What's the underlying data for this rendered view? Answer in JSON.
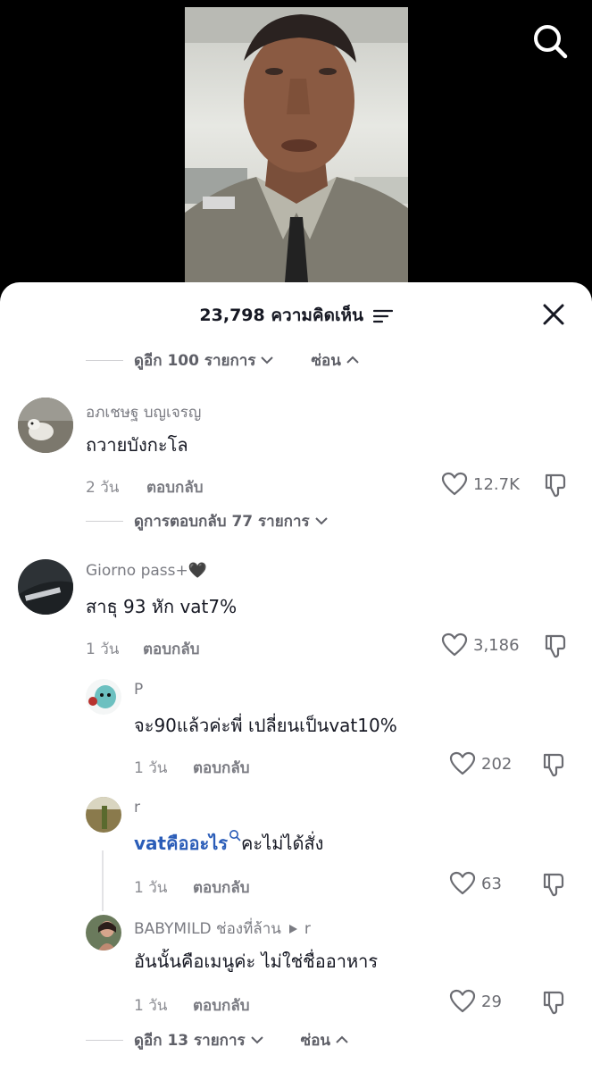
{
  "header": {
    "comment_count": "23,798 ความคิดเห็น"
  },
  "top_expand": {
    "more_label": "ดูอีก 100 รายการ",
    "hide_label": "ซ่อน"
  },
  "comments": [
    {
      "username": "อภเชษฐ บญเจรญ",
      "text": "ถวายบังกะโล",
      "time": "2 วัน",
      "reply_label": "ตอบกลับ",
      "likes": "12.7K",
      "view_replies": "ดูการตอบกลับ 77 รายการ"
    },
    {
      "username": "Giorno pass+🖤",
      "text": "สาธุ 93 หัก vat7%",
      "time": "1 วัน",
      "reply_label": "ตอบกลับ",
      "likes": "3,186"
    }
  ],
  "replies": [
    {
      "username": "P",
      "text": "จะ90แล้วค่ะพี่ เปลี่ยนเป็นvat10%",
      "time": "1 วัน",
      "reply_label": "ตอบกลับ",
      "likes": "202"
    },
    {
      "username": "r",
      "link_text": "vatคืออะไร",
      "text": "คะไม่ได้สั่ง",
      "time": "1 วัน",
      "reply_label": "ตอบกลับ",
      "likes": "63"
    },
    {
      "username": "BABYMILD ช่องที่ล้าน",
      "reply_to": "r",
      "text": "อันนั้นคือเมนูค่ะ ไม่ใช่ชื่ออาหาร",
      "time": "1 วัน",
      "reply_label": "ตอบกลับ",
      "likes": "29"
    }
  ],
  "bottom_expand": {
    "more_label": "ดูอีก 13 รายการ",
    "hide_label": "ซ่อน"
  },
  "colors": {
    "link": "#2b5db8",
    "text_primary": "#161823",
    "text_secondary": "#7a7b82"
  },
  "icons": [
    "search-icon",
    "filter-icon",
    "close-icon",
    "chevron-down-icon",
    "chevron-up-icon",
    "heart-icon",
    "dislike-icon",
    "search-small-icon",
    "play-arrow-icon"
  ]
}
